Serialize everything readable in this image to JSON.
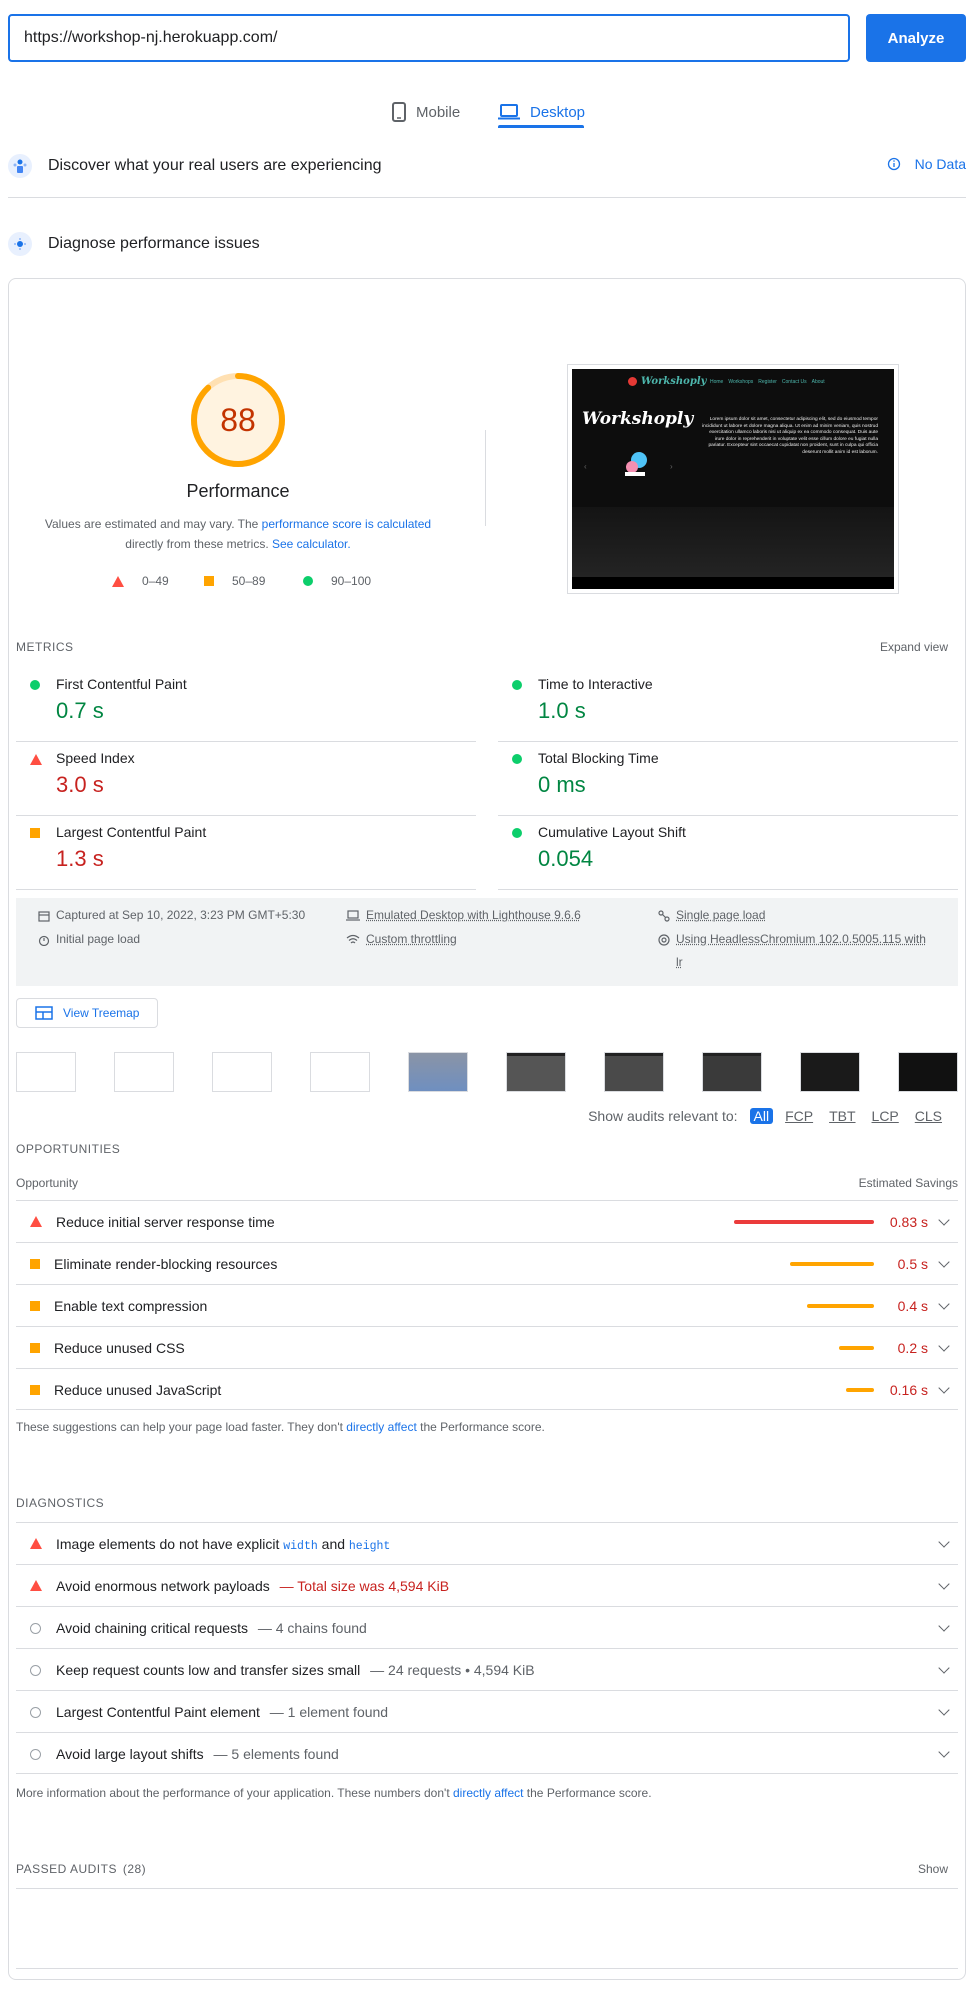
{
  "url_input": {
    "value": "https://workshop-nj.herokuapp.com/"
  },
  "analyze_label": "Analyze",
  "tabs": {
    "mobile": "Mobile",
    "desktop": "Desktop"
  },
  "crux": {
    "title": "Discover what your real users are experiencing",
    "no_data": "No Data"
  },
  "diagnose_title": "Diagnose performance issues",
  "score": {
    "value": "88",
    "fraction": 0.88,
    "color": "#ffa400",
    "label": "Performance"
  },
  "perf_note": {
    "prefix": "Values are estimated and may vary. The ",
    "link1": "performance score is calculated",
    "middle": " directly from these metrics. ",
    "link2": "See calculator."
  },
  "legend": {
    "red": "0–49",
    "orange": "50–89",
    "green": "90–100"
  },
  "screenshot": {
    "brand": "Workshoply",
    "nav": [
      "Home",
      "Workshops",
      "Register",
      "Contact Us",
      "About"
    ],
    "hero_title": "Workshoply",
    "lorem": "Lorem ipsum dolor sit amet, consectetur adipiscing elit, sed do eiusmod tempor incididunt ut labore et dolore magna aliqua. Ut enim ad minim veniam, quis nostrud exercitation ullamco laboris nisi ut aliquip ex ea commodo consequat. Duis aute irure dolor in reprehenderit in voluptate velit esse cillum dolore eu fugiat nulla pariatur. Excepteur sint occaecat cupidatat non proident, sunt in culpa qui officia deserunt mollit anim id est laborum."
  },
  "metrics": {
    "header": "METRICS",
    "expand": "Expand view",
    "items": [
      {
        "name": "First Contentful Paint",
        "value": "0.7 s",
        "status": "green"
      },
      {
        "name": "Time to Interactive",
        "value": "1.0 s",
        "status": "green"
      },
      {
        "name": "Speed Index",
        "value": "3.0 s",
        "status": "red"
      },
      {
        "name": "Total Blocking Time",
        "value": "0 ms",
        "status": "green"
      },
      {
        "name": "Largest Contentful Paint",
        "value": "1.3 s",
        "status": "orange"
      },
      {
        "name": "Cumulative Layout Shift",
        "value": "0.054",
        "status": "green"
      }
    ]
  },
  "env": {
    "captured": "Captured at Sep 10, 2022, 3:23 PM GMT+5:30",
    "initial": "Initial page load",
    "emulated": "Emulated Desktop with Lighthouse 9.6.6",
    "throttling": "Custom throttling",
    "single": "Single page load",
    "browser_line1": "Using HeadlessChromium 102.0.5005.115 with",
    "browser_line2": "lr"
  },
  "treemap_label": "View Treemap",
  "audits_filter": {
    "label": "Show audits relevant to:",
    "chips": [
      "All",
      "FCP",
      "TBT",
      "LCP",
      "CLS"
    ]
  },
  "opportunities": {
    "header": "OPPORTUNITIES",
    "col_left": "Opportunity",
    "col_right": "Estimated Savings",
    "items": [
      {
        "label": "Reduce initial server response time",
        "savings": "0.83 s",
        "fraction": 1.0,
        "status": "red"
      },
      {
        "label": "Eliminate render-blocking resources",
        "savings": "0.5 s",
        "fraction": 0.6,
        "status": "orange"
      },
      {
        "label": "Enable text compression",
        "savings": "0.4 s",
        "fraction": 0.48,
        "status": "orange"
      },
      {
        "label": "Reduce unused CSS",
        "savings": "0.2 s",
        "fraction": 0.25,
        "status": "orange"
      },
      {
        "label": "Reduce unused JavaScript",
        "savings": "0.16 s",
        "fraction": 0.2,
        "status": "orange"
      }
    ],
    "note": {
      "prefix": "These suggestions can help your page load faster. They don't ",
      "link": "directly affect",
      "suffix": " the Performance score."
    }
  },
  "diagnostics": {
    "header": "DIAGNOSTICS",
    "items": [
      {
        "label": "Image elements do not have explicit",
        "code1": "width",
        "and": "and",
        "code2": "height",
        "status": "red"
      },
      {
        "label": "Avoid enormous network payloads",
        "sub": "— Total size was 4,594 KiB",
        "status": "red"
      },
      {
        "label": "Avoid chaining critical requests",
        "sub": "— 4 chains found",
        "status": "info"
      },
      {
        "label": "Keep request counts low and transfer sizes small",
        "sub": "— 24 requests • 4,594 KiB",
        "status": "info"
      },
      {
        "label": "Largest Contentful Paint element",
        "sub": "— 1 element found",
        "status": "info"
      },
      {
        "label": "Avoid large layout shifts",
        "sub": "— 5 elements found",
        "status": "info"
      }
    ],
    "note": {
      "prefix": "More information about the performance of your application. These numbers don't ",
      "link": "directly affect",
      "suffix": " the Performance score."
    }
  },
  "passed": {
    "label": "PASSED AUDITS",
    "count": "(28)",
    "show": "Show"
  }
}
